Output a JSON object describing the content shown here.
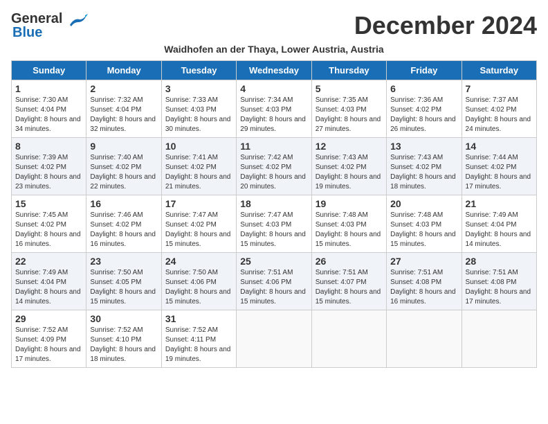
{
  "header": {
    "logo_line1": "General",
    "logo_line2": "Blue",
    "month_title": "December 2024",
    "location": "Waidhofen an der Thaya, Lower Austria, Austria"
  },
  "weekdays": [
    "Sunday",
    "Monday",
    "Tuesday",
    "Wednesday",
    "Thursday",
    "Friday",
    "Saturday"
  ],
  "weeks": [
    [
      {
        "day": "1",
        "sunrise": "Sunrise: 7:30 AM",
        "sunset": "Sunset: 4:04 PM",
        "daylight": "Daylight: 8 hours and 34 minutes."
      },
      {
        "day": "2",
        "sunrise": "Sunrise: 7:32 AM",
        "sunset": "Sunset: 4:04 PM",
        "daylight": "Daylight: 8 hours and 32 minutes."
      },
      {
        "day": "3",
        "sunrise": "Sunrise: 7:33 AM",
        "sunset": "Sunset: 4:03 PM",
        "daylight": "Daylight: 8 hours and 30 minutes."
      },
      {
        "day": "4",
        "sunrise": "Sunrise: 7:34 AM",
        "sunset": "Sunset: 4:03 PM",
        "daylight": "Daylight: 8 hours and 29 minutes."
      },
      {
        "day": "5",
        "sunrise": "Sunrise: 7:35 AM",
        "sunset": "Sunset: 4:03 PM",
        "daylight": "Daylight: 8 hours and 27 minutes."
      },
      {
        "day": "6",
        "sunrise": "Sunrise: 7:36 AM",
        "sunset": "Sunset: 4:02 PM",
        "daylight": "Daylight: 8 hours and 26 minutes."
      },
      {
        "day": "7",
        "sunrise": "Sunrise: 7:37 AM",
        "sunset": "Sunset: 4:02 PM",
        "daylight": "Daylight: 8 hours and 24 minutes."
      }
    ],
    [
      {
        "day": "8",
        "sunrise": "Sunrise: 7:39 AM",
        "sunset": "Sunset: 4:02 PM",
        "daylight": "Daylight: 8 hours and 23 minutes."
      },
      {
        "day": "9",
        "sunrise": "Sunrise: 7:40 AM",
        "sunset": "Sunset: 4:02 PM",
        "daylight": "Daylight: 8 hours and 22 minutes."
      },
      {
        "day": "10",
        "sunrise": "Sunrise: 7:41 AM",
        "sunset": "Sunset: 4:02 PM",
        "daylight": "Daylight: 8 hours and 21 minutes."
      },
      {
        "day": "11",
        "sunrise": "Sunrise: 7:42 AM",
        "sunset": "Sunset: 4:02 PM",
        "daylight": "Daylight: 8 hours and 20 minutes."
      },
      {
        "day": "12",
        "sunrise": "Sunrise: 7:43 AM",
        "sunset": "Sunset: 4:02 PM",
        "daylight": "Daylight: 8 hours and 19 minutes."
      },
      {
        "day": "13",
        "sunrise": "Sunrise: 7:43 AM",
        "sunset": "Sunset: 4:02 PM",
        "daylight": "Daylight: 8 hours and 18 minutes."
      },
      {
        "day": "14",
        "sunrise": "Sunrise: 7:44 AM",
        "sunset": "Sunset: 4:02 PM",
        "daylight": "Daylight: 8 hours and 17 minutes."
      }
    ],
    [
      {
        "day": "15",
        "sunrise": "Sunrise: 7:45 AM",
        "sunset": "Sunset: 4:02 PM",
        "daylight": "Daylight: 8 hours and 16 minutes."
      },
      {
        "day": "16",
        "sunrise": "Sunrise: 7:46 AM",
        "sunset": "Sunset: 4:02 PM",
        "daylight": "Daylight: 8 hours and 16 minutes."
      },
      {
        "day": "17",
        "sunrise": "Sunrise: 7:47 AM",
        "sunset": "Sunset: 4:02 PM",
        "daylight": "Daylight: 8 hours and 15 minutes."
      },
      {
        "day": "18",
        "sunrise": "Sunrise: 7:47 AM",
        "sunset": "Sunset: 4:03 PM",
        "daylight": "Daylight: 8 hours and 15 minutes."
      },
      {
        "day": "19",
        "sunrise": "Sunrise: 7:48 AM",
        "sunset": "Sunset: 4:03 PM",
        "daylight": "Daylight: 8 hours and 15 minutes."
      },
      {
        "day": "20",
        "sunrise": "Sunrise: 7:48 AM",
        "sunset": "Sunset: 4:03 PM",
        "daylight": "Daylight: 8 hours and 15 minutes."
      },
      {
        "day": "21",
        "sunrise": "Sunrise: 7:49 AM",
        "sunset": "Sunset: 4:04 PM",
        "daylight": "Daylight: 8 hours and 14 minutes."
      }
    ],
    [
      {
        "day": "22",
        "sunrise": "Sunrise: 7:49 AM",
        "sunset": "Sunset: 4:04 PM",
        "daylight": "Daylight: 8 hours and 14 minutes."
      },
      {
        "day": "23",
        "sunrise": "Sunrise: 7:50 AM",
        "sunset": "Sunset: 4:05 PM",
        "daylight": "Daylight: 8 hours and 15 minutes."
      },
      {
        "day": "24",
        "sunrise": "Sunrise: 7:50 AM",
        "sunset": "Sunset: 4:06 PM",
        "daylight": "Daylight: 8 hours and 15 minutes."
      },
      {
        "day": "25",
        "sunrise": "Sunrise: 7:51 AM",
        "sunset": "Sunset: 4:06 PM",
        "daylight": "Daylight: 8 hours and 15 minutes."
      },
      {
        "day": "26",
        "sunrise": "Sunrise: 7:51 AM",
        "sunset": "Sunset: 4:07 PM",
        "daylight": "Daylight: 8 hours and 15 minutes."
      },
      {
        "day": "27",
        "sunrise": "Sunrise: 7:51 AM",
        "sunset": "Sunset: 4:08 PM",
        "daylight": "Daylight: 8 hours and 16 minutes."
      },
      {
        "day": "28",
        "sunrise": "Sunrise: 7:51 AM",
        "sunset": "Sunset: 4:08 PM",
        "daylight": "Daylight: 8 hours and 17 minutes."
      }
    ],
    [
      {
        "day": "29",
        "sunrise": "Sunrise: 7:52 AM",
        "sunset": "Sunset: 4:09 PM",
        "daylight": "Daylight: 8 hours and 17 minutes."
      },
      {
        "day": "30",
        "sunrise": "Sunrise: 7:52 AM",
        "sunset": "Sunset: 4:10 PM",
        "daylight": "Daylight: 8 hours and 18 minutes."
      },
      {
        "day": "31",
        "sunrise": "Sunrise: 7:52 AM",
        "sunset": "Sunset: 4:11 PM",
        "daylight": "Daylight: 8 hours and 19 minutes."
      },
      null,
      null,
      null,
      null
    ]
  ]
}
